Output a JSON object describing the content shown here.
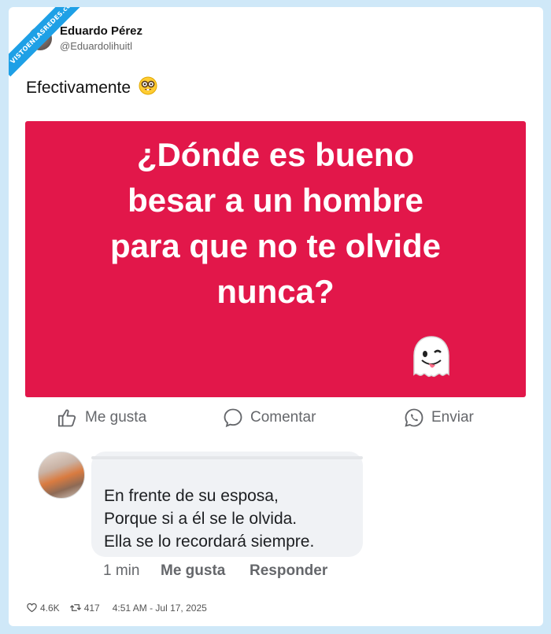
{
  "watermark": "VISTOENLASREDES.com",
  "author": {
    "name": "Eduardo Pérez",
    "handle": "@Eduardolihuitl"
  },
  "tweet": {
    "text": "Efectivamente",
    "emoji": "🤓"
  },
  "embedded_post": {
    "question": [
      "¿Dónde es bueno",
      "besar a un hombre",
      "para que no te olvide",
      "nunca?"
    ],
    "background_color": "#e2174a",
    "actions": {
      "like": "Me gusta",
      "comment": "Comentar",
      "share": "Enviar"
    },
    "comment": {
      "lines": [
        "En frente de su esposa,",
        "Porque si a él se le olvida.",
        "Ella se lo recordará siempre."
      ],
      "time": "1 min",
      "like": "Me gusta",
      "reply": "Responder"
    }
  },
  "stats": {
    "likes": "4.6K",
    "retweets": "417",
    "timestamp": "4:51 AM - Jul 17, 2025"
  }
}
